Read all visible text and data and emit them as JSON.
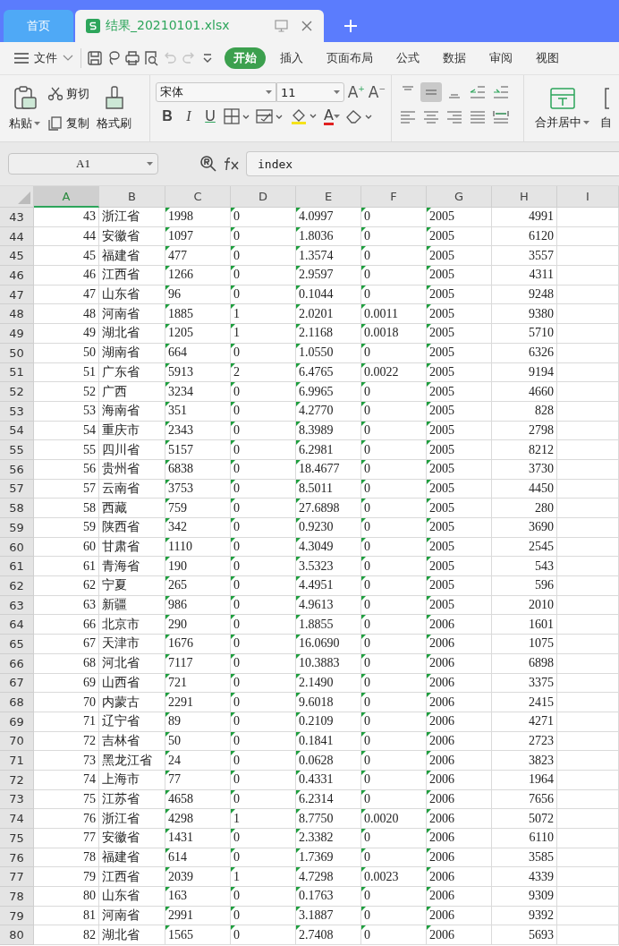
{
  "tabs": [
    {
      "label": "首页",
      "selected": false,
      "kind": "home"
    },
    {
      "label": "结果_20210101.xlsx",
      "selected": true,
      "kind": "file"
    }
  ],
  "menu": {
    "file_label": "文件",
    "quick_access": [
      {
        "kind": "save",
        "disabled": false
      },
      {
        "kind": "lasso",
        "disabled": false
      },
      {
        "kind": "print",
        "disabled": false
      },
      {
        "kind": "preview",
        "disabled": false
      },
      {
        "kind": "undo",
        "disabled": true
      },
      {
        "kind": "redo",
        "disabled": true
      },
      {
        "kind": "more",
        "disabled": false
      }
    ],
    "tabs": [
      {
        "label": "开始",
        "selected": true
      },
      {
        "label": "插入",
        "selected": false
      },
      {
        "label": "页面布局",
        "selected": false
      },
      {
        "label": "公式",
        "selected": false
      },
      {
        "label": "数据",
        "selected": false
      },
      {
        "label": "审阅",
        "selected": false
      },
      {
        "label": "视图",
        "selected": false
      }
    ]
  },
  "ribbon": {
    "paste": "粘贴",
    "cut": "剪切",
    "copy": "复制",
    "format_painter": "格式刷",
    "font_name": "宋体",
    "font_size": "11",
    "size_buttons": [
      {
        "label": "A",
        "sign": "+",
        "kind": "grow"
      },
      {
        "label": "A",
        "sign": "−",
        "kind": "shrink"
      }
    ],
    "styles": [
      {
        "label": "B",
        "kind": "bold"
      },
      {
        "label": "I",
        "kind": "italic"
      },
      {
        "label": "U",
        "kind": "underline"
      }
    ],
    "font_color_label": "A",
    "align_top": [
      {
        "kind": "top",
        "selected": false
      },
      {
        "kind": "middle",
        "selected": true
      },
      {
        "kind": "bottom",
        "selected": false
      },
      {
        "kind": "outdent",
        "selected": false
      },
      {
        "kind": "indent",
        "selected": false
      }
    ],
    "align_bottom": [
      {
        "kind": "left",
        "selected": false
      },
      {
        "kind": "center",
        "selected": false
      },
      {
        "kind": "right",
        "selected": false
      },
      {
        "kind": "justify",
        "selected": false
      },
      {
        "kind": "distribute",
        "selected": false
      }
    ],
    "merge": "合并居中",
    "wrap": "自"
  },
  "formula_bar": {
    "cell_ref": "A1",
    "formula": "index"
  },
  "sheet": {
    "columns": [
      {
        "label": "A",
        "kind": "number",
        "selected": true
      },
      {
        "label": "B",
        "kind": "label",
        "selected": false
      },
      {
        "label": "C",
        "kind": "numeric_text",
        "selected": false
      },
      {
        "label": "D",
        "kind": "numeric_text",
        "selected": false
      },
      {
        "label": "E",
        "kind": "numeric_text",
        "selected": false
      },
      {
        "label": "F",
        "kind": "numeric_text",
        "selected": false
      },
      {
        "label": "G",
        "kind": "numeric_text",
        "selected": false
      },
      {
        "label": "H",
        "kind": "number",
        "selected": false
      },
      {
        "label": "I",
        "kind": "empty",
        "selected": false
      }
    ],
    "rows": [
      {
        "header": "43",
        "cells": [
          "43",
          "浙江省",
          "1998",
          "0",
          "4.0997",
          "0",
          "2005",
          "4991"
        ]
      },
      {
        "header": "44",
        "cells": [
          "44",
          "安徽省",
          "1097",
          "0",
          "1.8036",
          "0",
          "2005",
          "6120"
        ]
      },
      {
        "header": "45",
        "cells": [
          "45",
          "福建省",
          "477",
          "0",
          "1.3574",
          "0",
          "2005",
          "3557"
        ]
      },
      {
        "header": "46",
        "cells": [
          "46",
          "江西省",
          "1266",
          "0",
          "2.9597",
          "0",
          "2005",
          "4311"
        ]
      },
      {
        "header": "47",
        "cells": [
          "47",
          "山东省",
          "96",
          "0",
          "0.1044",
          "0",
          "2005",
          "9248"
        ]
      },
      {
        "header": "48",
        "cells": [
          "48",
          "河南省",
          "1885",
          "1",
          "2.0201",
          "0.0011",
          "2005",
          "9380"
        ]
      },
      {
        "header": "49",
        "cells": [
          "49",
          "湖北省",
          "1205",
          "1",
          "2.1168",
          "0.0018",
          "2005",
          "5710"
        ]
      },
      {
        "header": "50",
        "cells": [
          "50",
          "湖南省",
          "664",
          "0",
          "1.0550",
          "0",
          "2005",
          "6326"
        ]
      },
      {
        "header": "51",
        "cells": [
          "51",
          "广东省",
          "5913",
          "2",
          "6.4765",
          "0.0022",
          "2005",
          "9194"
        ]
      },
      {
        "header": "52",
        "cells": [
          "52",
          "广西",
          "3234",
          "0",
          "6.9965",
          "0",
          "2005",
          "4660"
        ]
      },
      {
        "header": "53",
        "cells": [
          "53",
          "海南省",
          "351",
          "0",
          "4.2770",
          "0",
          "2005",
          "828"
        ]
      },
      {
        "header": "54",
        "cells": [
          "54",
          "重庆市",
          "2343",
          "0",
          "8.3989",
          "0",
          "2005",
          "2798"
        ]
      },
      {
        "header": "55",
        "cells": [
          "55",
          "四川省",
          "5157",
          "0",
          "6.2981",
          "0",
          "2005",
          "8212"
        ]
      },
      {
        "header": "56",
        "cells": [
          "56",
          "贵州省",
          "6838",
          "0",
          "18.4677",
          "0",
          "2005",
          "3730"
        ]
      },
      {
        "header": "57",
        "cells": [
          "57",
          "云南省",
          "3753",
          "0",
          "8.5011",
          "0",
          "2005",
          "4450"
        ]
      },
      {
        "header": "58",
        "cells": [
          "58",
          "西藏",
          "759",
          "0",
          "27.6898",
          "0",
          "2005",
          "280"
        ]
      },
      {
        "header": "59",
        "cells": [
          "59",
          "陕西省",
          "342",
          "0",
          "0.9230",
          "0",
          "2005",
          "3690"
        ]
      },
      {
        "header": "60",
        "cells": [
          "60",
          "甘肃省",
          "1110",
          "0",
          "4.3049",
          "0",
          "2005",
          "2545"
        ]
      },
      {
        "header": "61",
        "cells": [
          "61",
          "青海省",
          "190",
          "0",
          "3.5323",
          "0",
          "2005",
          "543"
        ]
      },
      {
        "header": "62",
        "cells": [
          "62",
          "宁夏",
          "265",
          "0",
          "4.4951",
          "0",
          "2005",
          "596"
        ]
      },
      {
        "header": "63",
        "cells": [
          "63",
          "新疆",
          "986",
          "0",
          "4.9613",
          "0",
          "2005",
          "2010"
        ]
      },
      {
        "header": "64",
        "cells": [
          "66",
          "北京市",
          "290",
          "0",
          "1.8855",
          "0",
          "2006",
          "1601"
        ]
      },
      {
        "header": "65",
        "cells": [
          "67",
          "天津市",
          "1676",
          "0",
          "16.0690",
          "0",
          "2006",
          "1075"
        ]
      },
      {
        "header": "66",
        "cells": [
          "68",
          "河北省",
          "7117",
          "0",
          "10.3883",
          "0",
          "2006",
          "6898"
        ]
      },
      {
        "header": "67",
        "cells": [
          "69",
          "山西省",
          "721",
          "0",
          "2.1490",
          "0",
          "2006",
          "3375"
        ]
      },
      {
        "header": "68",
        "cells": [
          "70",
          "内蒙古",
          "2291",
          "0",
          "9.6018",
          "0",
          "2006",
          "2415"
        ]
      },
      {
        "header": "69",
        "cells": [
          "71",
          "辽宁省",
          "89",
          "0",
          "0.2109",
          "0",
          "2006",
          "4271"
        ]
      },
      {
        "header": "70",
        "cells": [
          "72",
          "吉林省",
          "50",
          "0",
          "0.1841",
          "0",
          "2006",
          "2723"
        ]
      },
      {
        "header": "71",
        "cells": [
          "73",
          "黑龙江省",
          "24",
          "0",
          "0.0628",
          "0",
          "2006",
          "3823"
        ]
      },
      {
        "header": "72",
        "cells": [
          "74",
          "上海市",
          "77",
          "0",
          "0.4331",
          "0",
          "2006",
          "1964"
        ]
      },
      {
        "header": "73",
        "cells": [
          "75",
          "江苏省",
          "4658",
          "0",
          "6.2314",
          "0",
          "2006",
          "7656"
        ]
      },
      {
        "header": "74",
        "cells": [
          "76",
          "浙江省",
          "4298",
          "1",
          "8.7750",
          "0.0020",
          "2006",
          "5072"
        ]
      },
      {
        "header": "75",
        "cells": [
          "77",
          "安徽省",
          "1431",
          "0",
          "2.3382",
          "0",
          "2006",
          "6110"
        ]
      },
      {
        "header": "76",
        "cells": [
          "78",
          "福建省",
          "614",
          "0",
          "1.7369",
          "0",
          "2006",
          "3585"
        ]
      },
      {
        "header": "77",
        "cells": [
          "79",
          "江西省",
          "2039",
          "1",
          "4.7298",
          "0.0023",
          "2006",
          "4339"
        ]
      },
      {
        "header": "78",
        "cells": [
          "80",
          "山东省",
          "163",
          "0",
          "0.1763",
          "0",
          "2006",
          "9309"
        ]
      },
      {
        "header": "79",
        "cells": [
          "81",
          "河南省",
          "2991",
          "0",
          "3.1887",
          "0",
          "2006",
          "9392"
        ]
      },
      {
        "header": "80",
        "cells": [
          "82",
          "湖北省",
          "1565",
          "0",
          "2.7408",
          "0",
          "2006",
          "5693"
        ]
      }
    ]
  }
}
